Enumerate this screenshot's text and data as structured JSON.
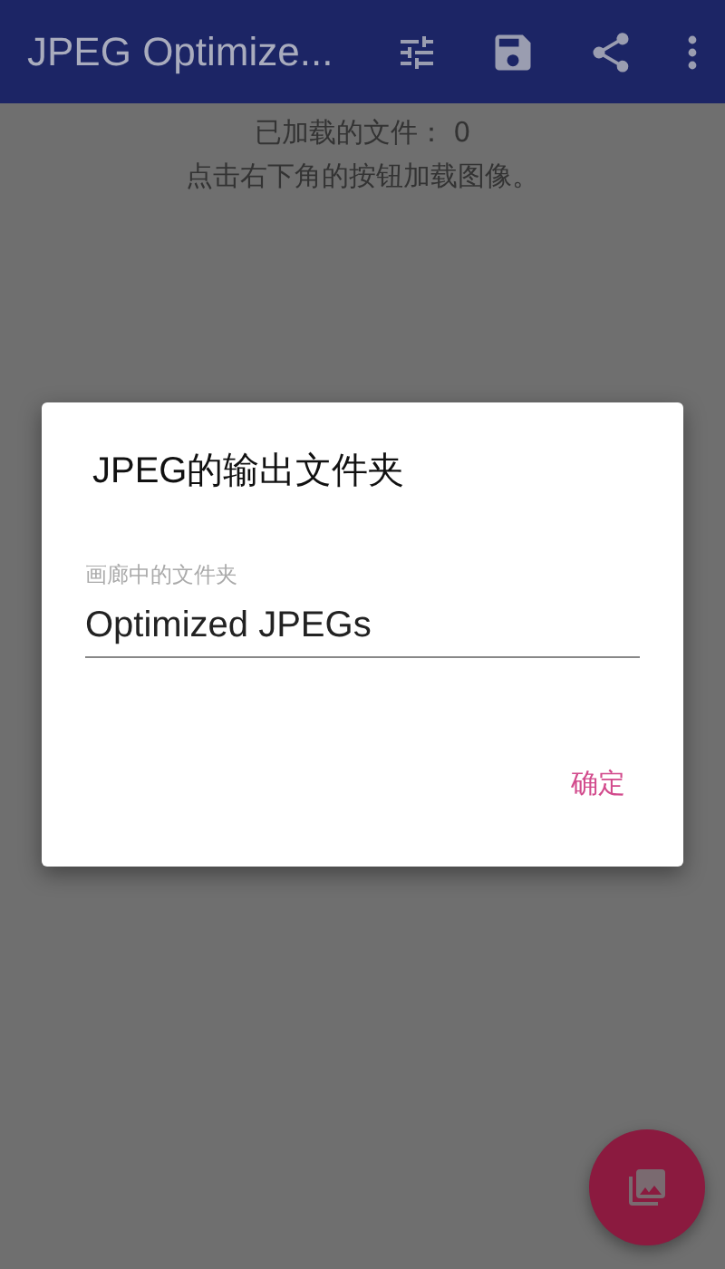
{
  "app_bar": {
    "title": "JPEG Optimize..."
  },
  "status": {
    "loaded_label": "已加载的文件： 0",
    "hint": "点击右下角的按钮加载图像。"
  },
  "dialog": {
    "title": "JPEG的输出文件夹",
    "field": {
      "label": "画廊中的文件夹",
      "value": "Optimized JPEGs"
    },
    "buttons": [
      "确定"
    ]
  }
}
